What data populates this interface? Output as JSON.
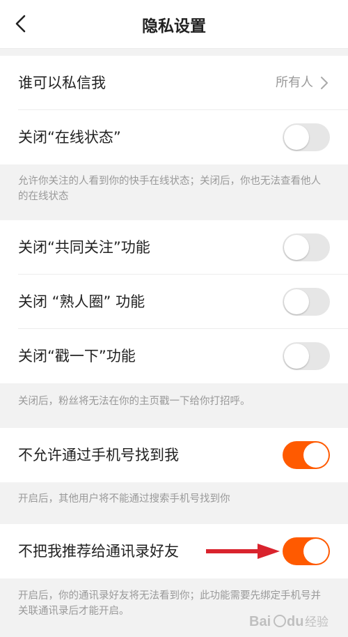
{
  "header": {
    "title": "隐私设置",
    "back_icon": "chevron-left-icon"
  },
  "rows": [
    {
      "label": "谁可以私信我",
      "value": "所有人"
    },
    {
      "label": "关闭“在线状态”",
      "toggle": "off"
    },
    {
      "label": "关闭“共同关注”功能",
      "toggle": "off"
    },
    {
      "label": "关闭 “熟人圈” 功能",
      "toggle": "off"
    },
    {
      "label": "关闭“戳一下”功能",
      "toggle": "off"
    },
    {
      "label": "不允许通过手机号找到我",
      "toggle": "on"
    },
    {
      "label": "不把我推荐给通讯录好友",
      "toggle": "on"
    }
  ],
  "notes": [
    "允许你关注的人看到你的快手在线状态；关闭后，你也无法查看他人的在线状态",
    "关闭后，粉丝将无法在你的主页戳一下给你打招呼。",
    "开启后，其他用户将不能通过搜索手机号找到你",
    "开启后，你的通讯录好友将无法看到你；此功能需要先绑定手机号并关联通讯录后才能开启。"
  ],
  "colors": {
    "accent": "#ff5a00",
    "annotation_arrow": "#d9232d"
  },
  "watermark": "Baidu 经验"
}
